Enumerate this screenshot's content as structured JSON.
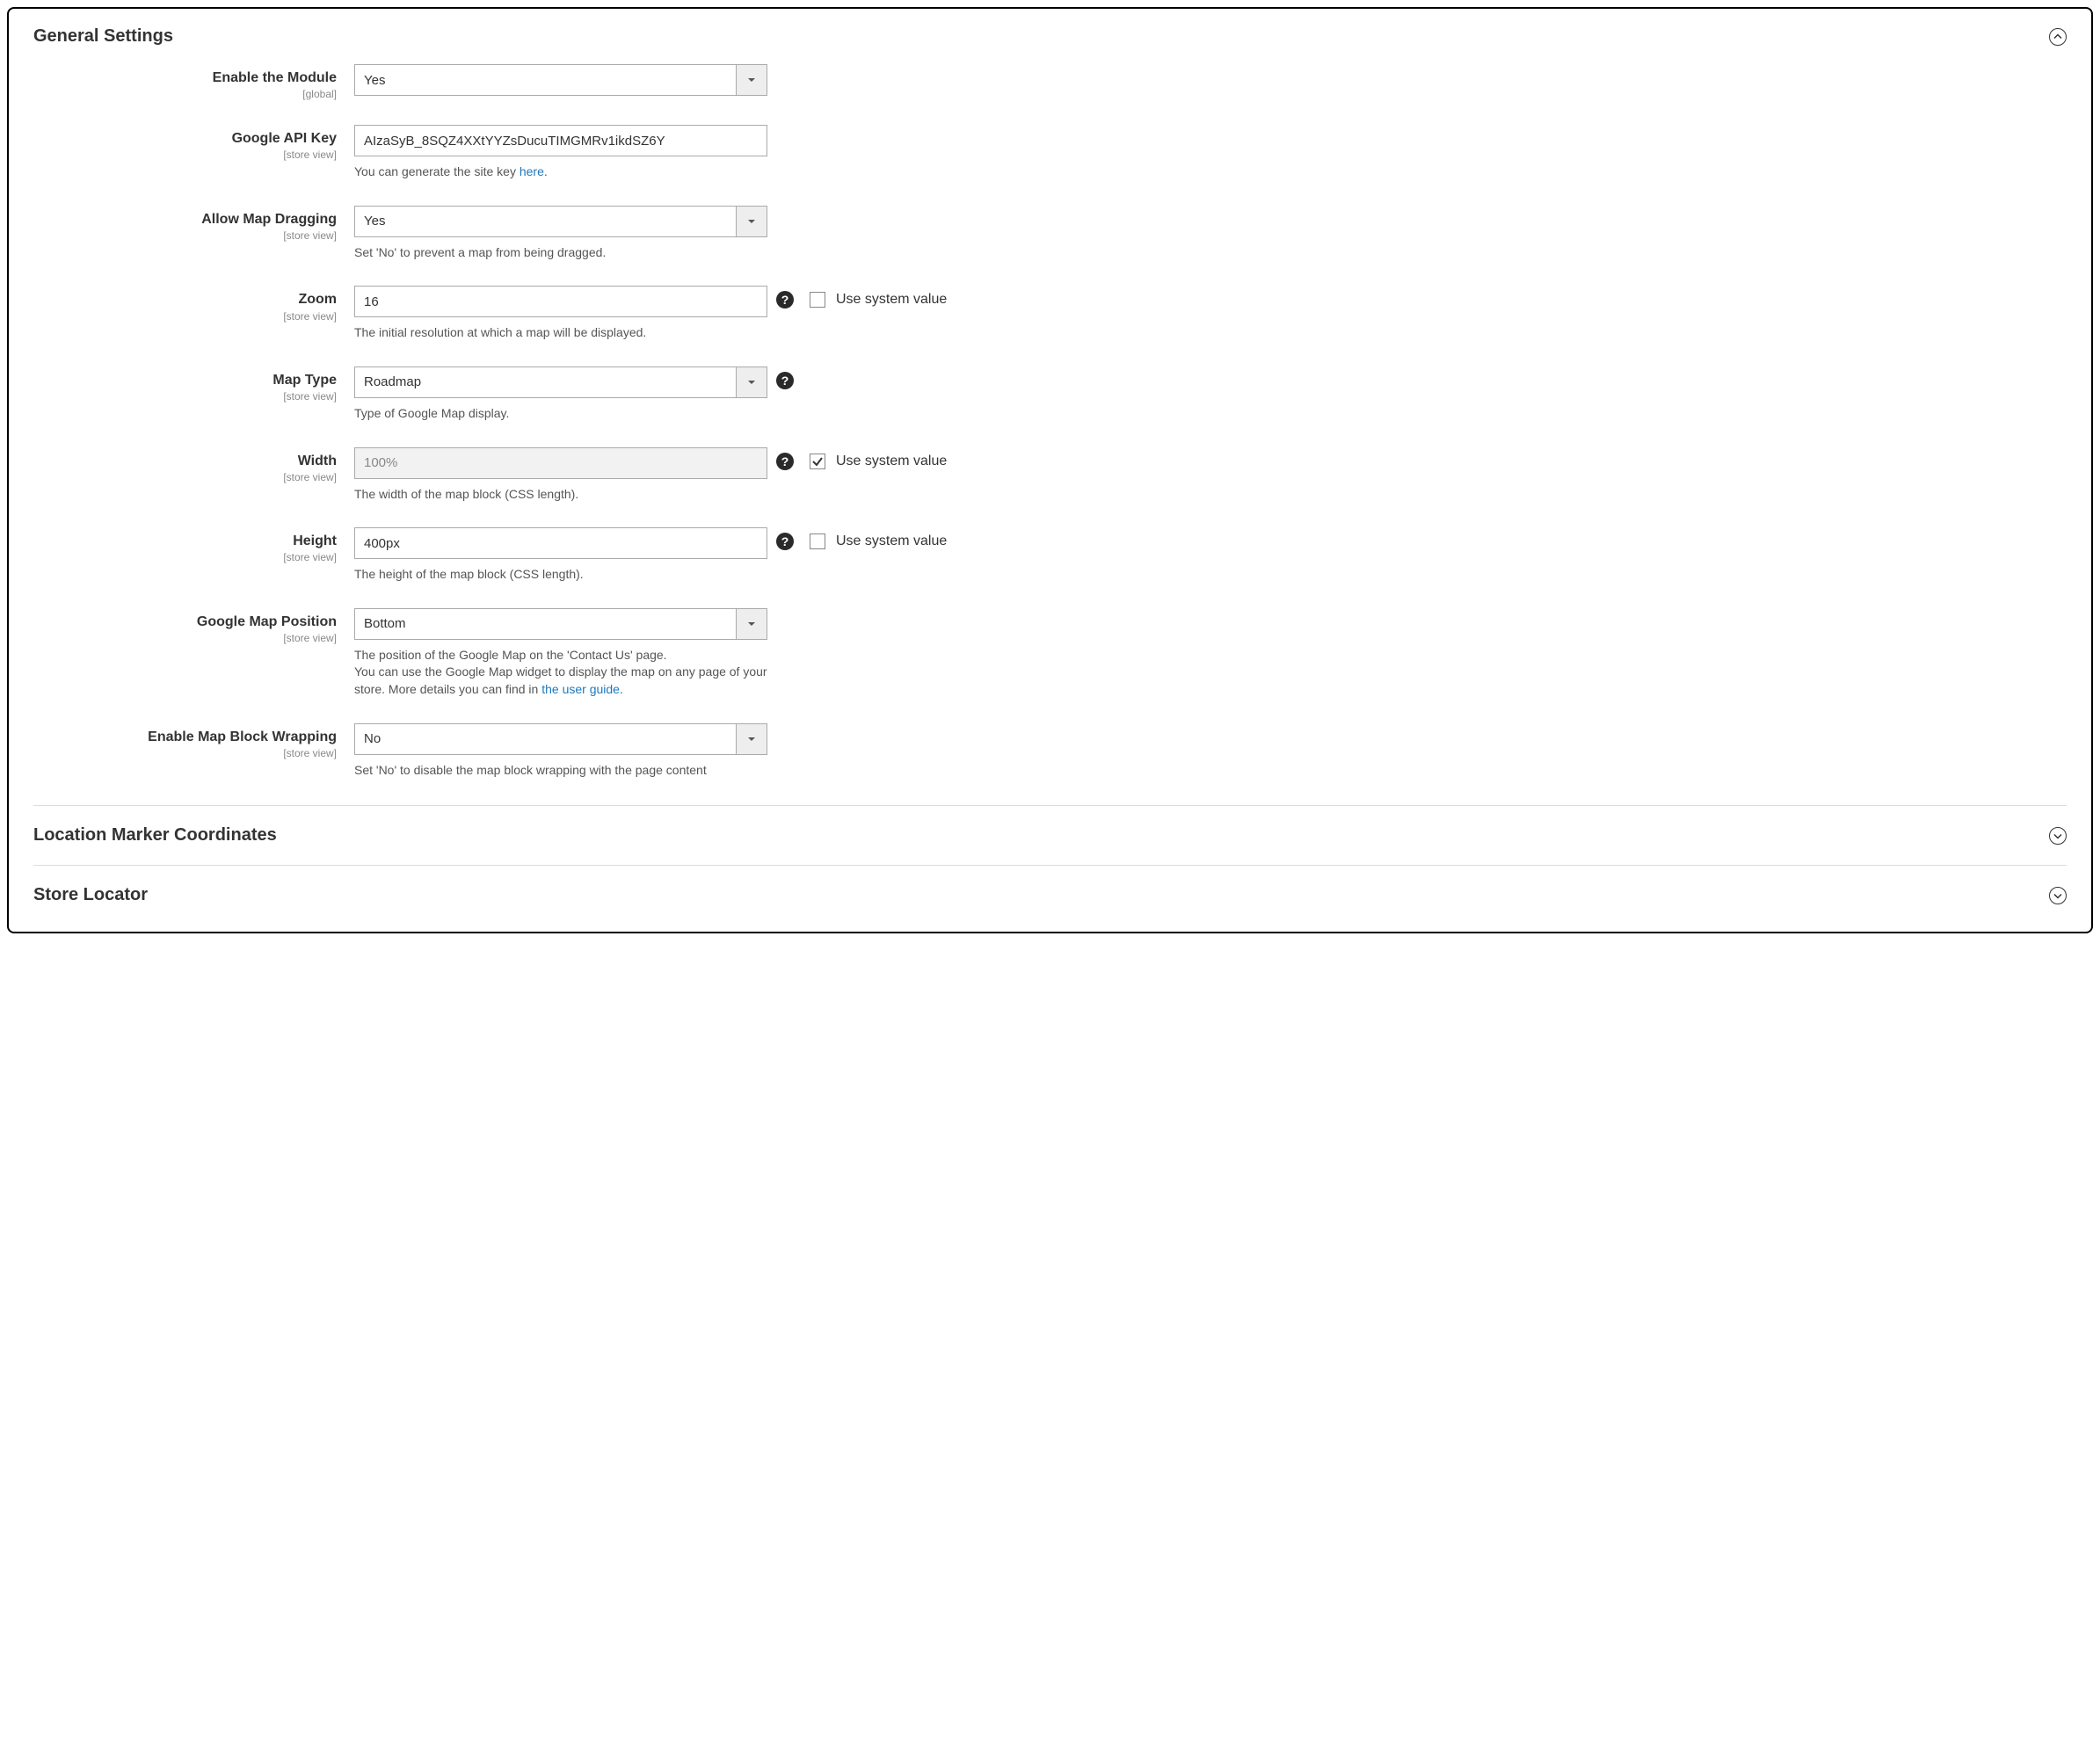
{
  "sections": {
    "general": {
      "title": "General Settings"
    },
    "marker": {
      "title": "Location Marker Coordinates"
    },
    "store_locator": {
      "title": "Store Locator"
    }
  },
  "scopes": {
    "global": "[global]",
    "store_view": "[store view]"
  },
  "common": {
    "use_system_value": "Use system value",
    "here": "here",
    "user_guide": "the user guide"
  },
  "fields": {
    "enable_module": {
      "label": "Enable the Module",
      "value": "Yes"
    },
    "google_api_key": {
      "label": "Google API Key",
      "value": "AIzaSyB_8SQZ4XXtYYZsDucuTIMGMRv1ikdSZ6Y",
      "hint_prefix": "You can generate the site key ",
      "hint_suffix": "."
    },
    "allow_dragging": {
      "label": "Allow Map Dragging",
      "value": "Yes",
      "hint": "Set 'No' to prevent a map from being dragged."
    },
    "zoom": {
      "label": "Zoom",
      "value": "16",
      "hint": "The initial resolution at which a map will be displayed."
    },
    "map_type": {
      "label": "Map Type",
      "value": "Roadmap",
      "hint": "Type of Google Map display."
    },
    "width": {
      "label": "Width",
      "value": "100%",
      "hint": "The width of the map block (CSS length)."
    },
    "height": {
      "label": "Height",
      "value": "400px",
      "hint": "The height of the map block (CSS length)."
    },
    "map_position": {
      "label": "Google Map Position",
      "value": "Bottom",
      "hint_line1": "The position of the Google Map on the 'Contact Us' page.",
      "hint_line2_a": "You can use the Google Map widget to display the map on any page of your store. More details you can find in ",
      "hint_line2_b": "."
    },
    "block_wrapping": {
      "label": "Enable Map Block Wrapping",
      "value": "No",
      "hint": "Set 'No' to disable the map block wrapping with the page content"
    }
  }
}
